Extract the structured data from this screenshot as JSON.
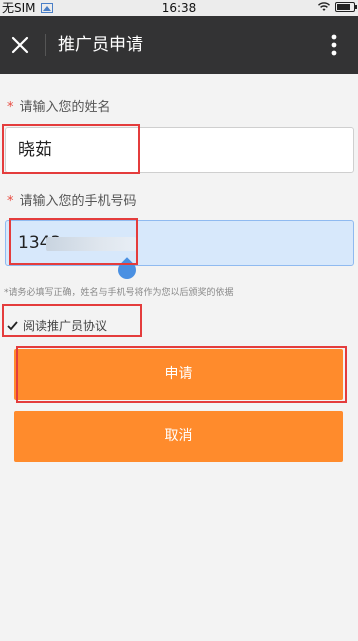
{
  "status_bar": {
    "carrier": "无SIM",
    "time": "16:38",
    "battery_level": 0.7
  },
  "title_bar": {
    "title": "推广员申请"
  },
  "form": {
    "name_label": "请输入您的姓名",
    "name_value": "晓茹",
    "phone_label": "请输入您的手机号码",
    "phone_value": "1343",
    "required_mark": "*",
    "hint": "*请务必填写正确，姓名与手机号将作为您以后颁奖的依据",
    "agreement_label": "阅读推广员协议",
    "agreement_checked": true
  },
  "buttons": {
    "apply_label": "申请",
    "cancel_label": "取消"
  },
  "colors": {
    "accent": "#ff8b2c",
    "title_bar": "#333334",
    "highlight": "#e43c3c",
    "focus_input": "#d7e8fb"
  }
}
